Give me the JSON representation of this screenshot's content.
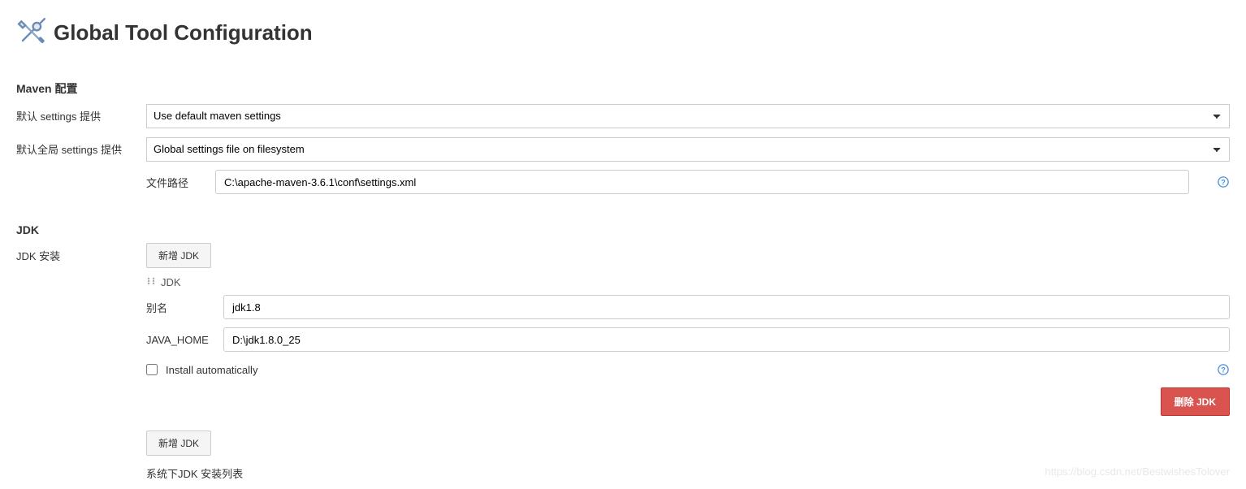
{
  "page": {
    "title": "Global Tool Configuration"
  },
  "sections": {
    "maven": {
      "title": "Maven 配置",
      "default_settings_label": "默认 settings 提供",
      "default_settings_value": "Use default maven settings",
      "global_settings_label": "默认全局 settings 提供",
      "global_settings_value": "Global settings file on filesystem",
      "file_path_label": "文件路径",
      "file_path_value": "C:\\apache-maven-3.6.1\\conf\\settings.xml"
    },
    "jdk": {
      "title": "JDK",
      "install_label": "JDK 安装",
      "add_button": "新增 JDK",
      "entry_header": "JDK",
      "alias_label": "别名",
      "alias_value": "jdk1.8",
      "java_home_label": "JAVA_HOME",
      "java_home_value": "D:\\jdk1.8.0_25",
      "install_auto_label": "Install automatically",
      "install_auto_checked": false,
      "delete_button": "删除 JDK",
      "add_button_bottom": "新增 JDK",
      "footer_note": "系统下JDK 安装列表"
    }
  },
  "watermark": "https://blog.csdn.net/BestwishesTolover"
}
